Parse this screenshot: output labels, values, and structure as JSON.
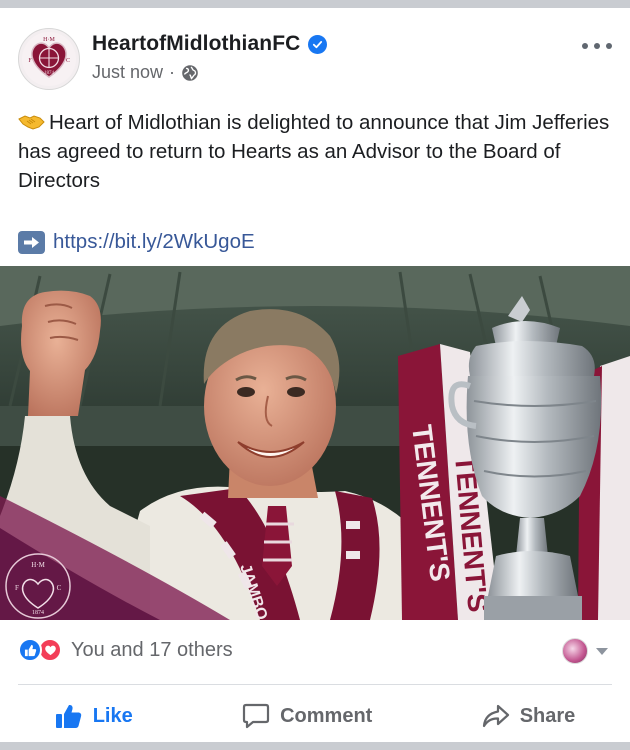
{
  "post": {
    "page_name": "HeartofMidlothianFC",
    "timestamp": "Just now",
    "separator": "·",
    "text": "Heart of Midlothian is delighted to announce that Jim Jefferies has agreed to return to Hearts as an Advisor to the Board of Directors",
    "link": "https://bit.ly/2WkUgoE",
    "avatar_crest_text": "H·M F C 1874"
  },
  "icons": {
    "verified": "verified-badge-icon",
    "audience": "globe-icon",
    "more": "more-options-icon",
    "handshake": "handshake-emoji-icon",
    "arrow": "right-arrow-emoji-icon",
    "like": "thumbs-up-icon",
    "comment": "comment-bubble-icon",
    "share": "share-arrow-icon"
  },
  "reactions": {
    "summary": "You and 17 others"
  },
  "actions": {
    "like": "Like",
    "comment": "Comment",
    "share": "Share"
  },
  "photo": {
    "trophy_ribbon_text": "TENNENT'S",
    "scarf_text": "JAMBO"
  },
  "colors": {
    "accent_blue": "#1877f2",
    "link": "#385898",
    "maroon": "#8a1538",
    "love_red": "#f33e58"
  }
}
